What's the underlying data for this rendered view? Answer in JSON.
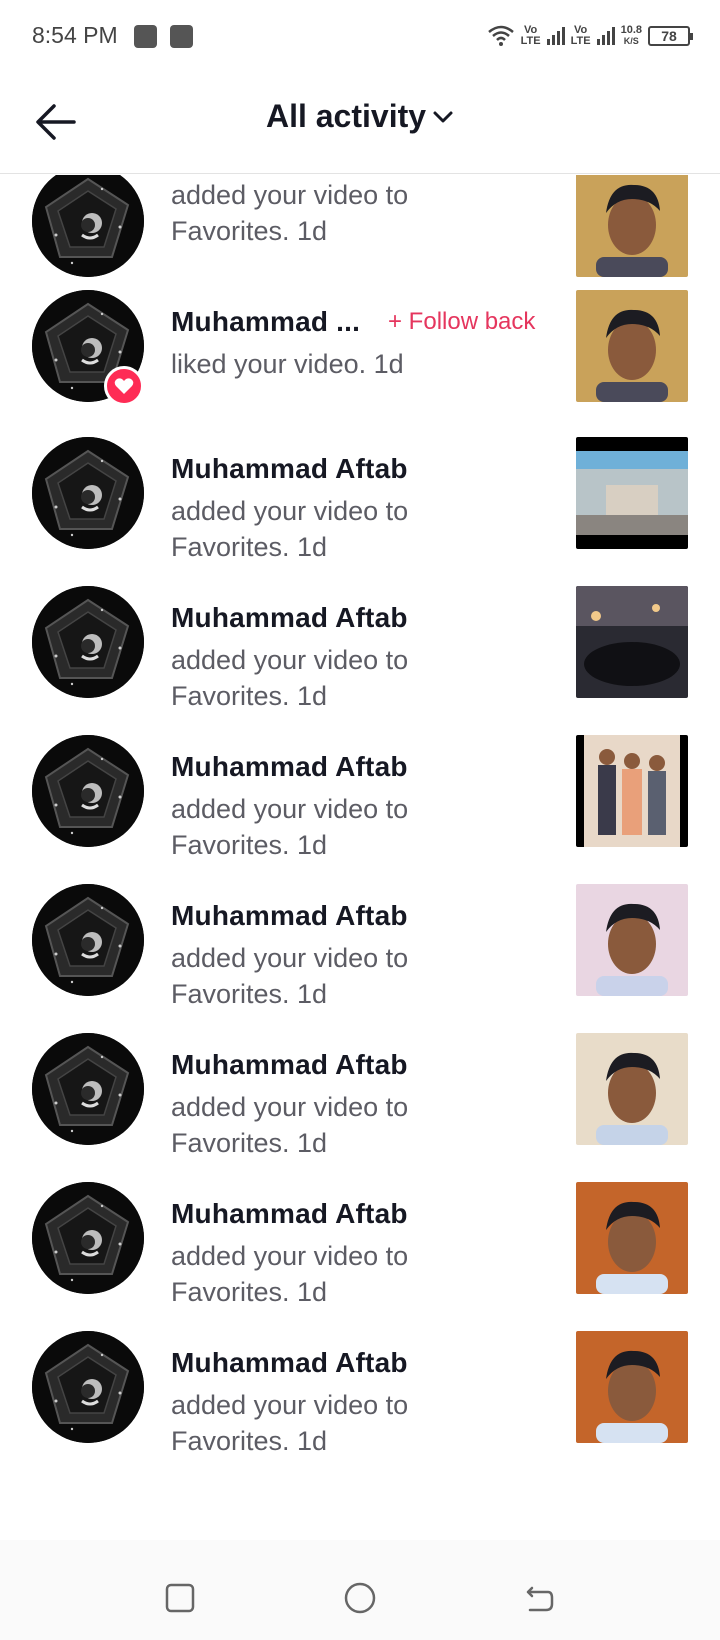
{
  "status_bar": {
    "time": "8:54 PM",
    "network_speed_value": "10.8",
    "network_speed_unit": "K/S",
    "sim1_label": "Vo\nLTE",
    "sim2_label": "Vo\nLTE",
    "battery": "78"
  },
  "header": {
    "title": "All activity",
    "back_icon": "arrow-left-icon",
    "dropdown_icon": "chevron-down-icon"
  },
  "follow_back_label": "+ Follow back",
  "activities": [
    {
      "name": "",
      "action": "added your video to Favorites. 1d"
    },
    {
      "name": "Muhammad ...",
      "action": "liked your video. 1d"
    },
    {
      "name": "Muhammad Aftab",
      "action": "added your video to Favorites. 1d"
    },
    {
      "name": "Muhammad Aftab",
      "action": "added your video to Favorites. 1d"
    },
    {
      "name": "Muhammad Aftab",
      "action": "added your video to Favorites. 1d"
    },
    {
      "name": "Muhammad Aftab",
      "action": "added your video to Favorites. 1d"
    },
    {
      "name": "Muhammad Aftab",
      "action": "added your video to Favorites. 1d"
    },
    {
      "name": "Muhammad Aftab",
      "action": "added your video to Favorites. 1d"
    },
    {
      "name": "Muhammad Aftab",
      "action": "added your video to Favorites. 1d"
    }
  ],
  "nav": {
    "recents_icon": "square-icon",
    "home_icon": "circle-icon",
    "back_icon": "back-arrow-icon"
  },
  "colors": {
    "accent": "#fe2c55",
    "follow_text": "#e5365e",
    "secondary_text": "#5c5c64"
  }
}
